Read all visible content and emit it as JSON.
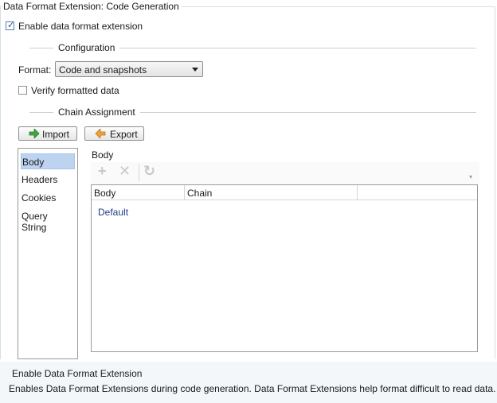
{
  "group_title": "Data Format Extension: Code Generation",
  "enable_checkbox": {
    "label": "Enable data format extension",
    "checked": true
  },
  "configuration": {
    "title": "Configuration",
    "format_label": "Format:",
    "format_value": "Code and snapshots",
    "verify_label": "Verify formatted data",
    "verify_checked": false
  },
  "chain_assignment": {
    "title": "Chain Assignment",
    "import_label": "Import",
    "export_label": "Export"
  },
  "sections": [
    "Body",
    "Headers",
    "Cookies",
    "Query String"
  ],
  "selected_section": "Body",
  "panel": {
    "title": "Body",
    "toolbar": [
      "add-icon",
      "delete-icon",
      "refresh-icon"
    ],
    "columns": [
      "Body",
      "Chain",
      ""
    ],
    "rows": [
      {
        "body": "Default",
        "chain": ""
      }
    ]
  },
  "help": {
    "title": "Enable Data Format Extension",
    "description": "Enables Data Format Extensions during code generation. Data Format Extensions help format difficult to read data."
  },
  "colors": {
    "selection": "#bdd3f0",
    "link_text": "#1f3b8a",
    "check": "#2b4a8c"
  }
}
